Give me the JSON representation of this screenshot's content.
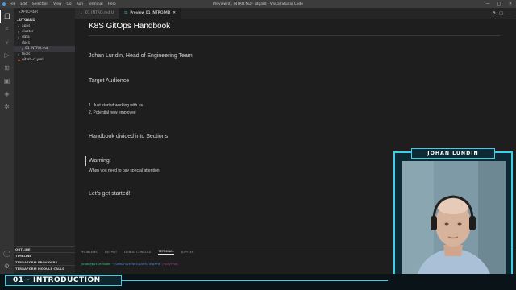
{
  "titlebar": {
    "menu": [
      "File",
      "Edit",
      "Selection",
      "View",
      "Go",
      "Run",
      "Terminal",
      "Help"
    ],
    "window_title": "Preview 01 INTRO.MD - utgard - Visual Studio Code"
  },
  "sidebar": {
    "header": "EXPLORER",
    "root": "UTGARD",
    "items": [
      {
        "label": "apps",
        "type": "folder"
      },
      {
        "label": "cluster",
        "type": "folder"
      },
      {
        "label": "data",
        "type": "folder"
      },
      {
        "label": "docs",
        "type": "folder-open"
      },
      {
        "label": "01 INTRO.md",
        "type": "file-md"
      },
      {
        "label": "tools",
        "type": "folder"
      },
      {
        "label": "gitlab-ci.yml",
        "type": "file-gitlab"
      }
    ],
    "sections": [
      "OUTLINE",
      "TIMELINE",
      "TERRAFORM PROVIDERS",
      "TERRAFORM MODULE CALLS"
    ]
  },
  "tabs": [
    {
      "label": "01 INTRO.md U",
      "active": false
    },
    {
      "label": "Preview 01 INTRO.MD",
      "active": true
    }
  ],
  "preview": {
    "heading": "K8S GitOps Handbook",
    "author": "Johan Lundin, Head of Engineering Team",
    "audience_title": "Target Audience",
    "audience_items": [
      "1. Just started working with us",
      "2. Potential new employee"
    ],
    "sections_title": "Handbook divided into Sections",
    "warning_title": "Warning!",
    "warning_text": "When you need to pay special attention",
    "closing": "Let's get started!"
  },
  "panel": {
    "tabs": [
      "PROBLEMS",
      "OUTPUT",
      "DEBUG CONSOLE",
      "TERMINAL",
      "JUPYTER"
    ],
    "active_tab": "TERMINAL",
    "prompt_user": "johan@bitterdude",
    "prompt_path": "~/OneDrive/dev/work/utgard",
    "prompt_branch": "(run/rnd)"
  },
  "overlay": {
    "banner_title": "01 - INTRODUCTION",
    "presenter_name": "JOHAN LUNDIN"
  },
  "colors": {
    "accent": "#3ecfe8",
    "editor_bg": "#1e1e1e",
    "sidebar_bg": "#252526",
    "activity_bg": "#333333"
  }
}
